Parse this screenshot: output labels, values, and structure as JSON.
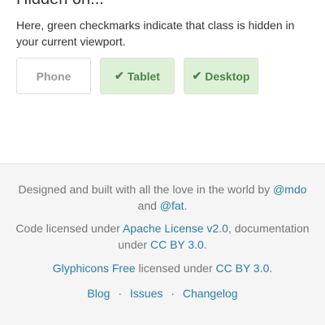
{
  "section": {
    "heading": "Hidden on...",
    "description": "Here, green checkmarks indicate that class is hidden in your current viewport.",
    "boxes": [
      {
        "label": "Phone",
        "checked": false,
        "check": ""
      },
      {
        "label": "Tablet",
        "checked": true,
        "check": "✔"
      },
      {
        "label": "Desktop",
        "checked": true,
        "check": "✔"
      }
    ]
  },
  "footer": {
    "line1_text": "Designed and built with all the love in the world by",
    "line1_link": "@mdo",
    "line1_and": "and",
    "line1_link2": "@fat",
    "line1_end": ".",
    "line2_text": "Code licensed under",
    "line2_link": "Apache License v2.0",
    "line2_mid": ", documentation under",
    "line2_link2": "CC BY 3.0",
    "line2_end": ".",
    "line3_link": "Glyphicons Free",
    "line3_text": "licensed under",
    "line3_link2": "CC BY 3.0",
    "line3_end": ".",
    "links": [
      "Blog",
      "Issues",
      "Changelog"
    ],
    "separator": "·"
  },
  "colors": {
    "link": "#2a7fa8",
    "success_bg": "#dff0d8",
    "success_text": "#468847",
    "footer_bg": "#f5f5f5"
  }
}
